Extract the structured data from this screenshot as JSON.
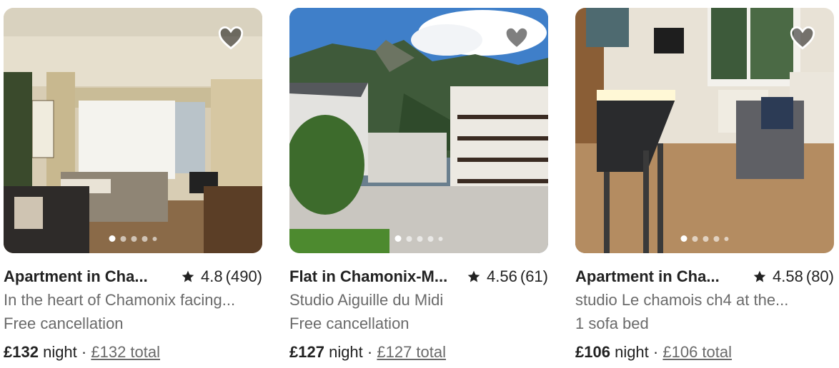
{
  "listings": [
    {
      "title": "Apartment in Cha...",
      "rating": "4.8",
      "reviews": "(490)",
      "description": "In the heart of Chamonix facing...",
      "detail": "Free cancellation",
      "price": "£132",
      "unit": "night",
      "separator": "·",
      "total": "£132 total",
      "photo_count": 5,
      "active_photo": 1
    },
    {
      "title": "Flat in Chamonix-M...",
      "rating": "4.56",
      "reviews": "(61)",
      "description": "Studio Aiguille du Midi",
      "detail": "Free cancellation",
      "price": "£127",
      "unit": "night",
      "separator": "·",
      "total": "£127 total",
      "photo_count": 5,
      "active_photo": 1
    },
    {
      "title": "Apartment in Cha...",
      "rating": "4.58",
      "reviews": "(80)",
      "description": "studio Le chamois ch4 at the...",
      "detail": "1 sofa bed",
      "price": "£106",
      "unit": "night",
      "separator": "·",
      "total": "£106 total",
      "photo_count": 5,
      "active_photo": 1
    }
  ],
  "icons": {
    "favorite": "heart-icon",
    "rating": "star-icon"
  },
  "colors": {
    "text_primary": "#222222",
    "text_secondary": "#6a6a6a"
  }
}
